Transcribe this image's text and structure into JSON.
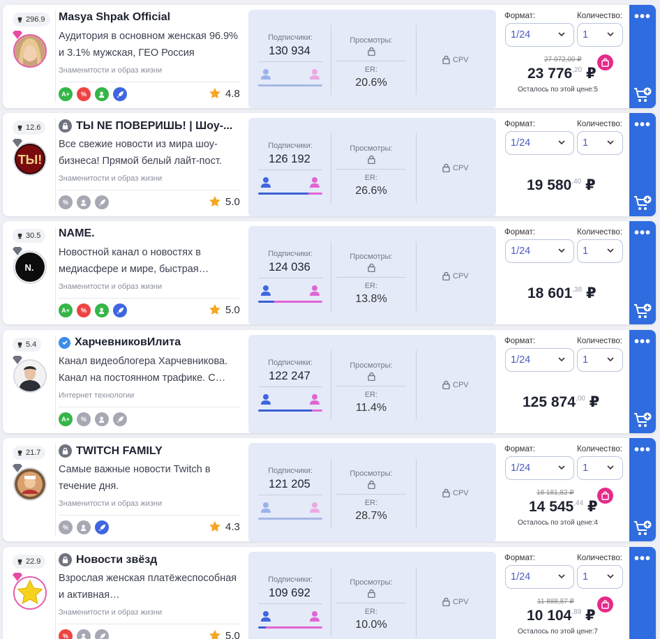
{
  "labels": {
    "subscribers": "Подписчики:",
    "views": "Просмотры:",
    "er": "ER:",
    "cpv": "CPV",
    "format": "Формат:",
    "quantity": "Количество:",
    "more": "•••"
  },
  "colors": {
    "accent": "#2f6ce0",
    "discount": "#e52a8a",
    "male": "#3f66e0",
    "female": "#e066d4"
  },
  "channels": [
    {
      "rank": "296.9",
      "name": "Masya Shpak Official",
      "desc": "Аудитория в основном женская 96.9% и 3.1% мужская, ГЕО Россия",
      "category": "Знаменитости и образ жизни",
      "subscribers": "130 934",
      "er": "20.6%",
      "male_share": 0.031,
      "format": "1/24",
      "qty": "1",
      "old_price": "27 972",
      "old_price_frac": ",00 ₽",
      "price": "23 776",
      "price_frac": ",20",
      "currency": "₽",
      "left_note": "Осталось по этой цене:5",
      "rating": "4.8",
      "tags": [
        "A+",
        "%",
        "pulse",
        "rocket"
      ]
    },
    {
      "rank": "12.6",
      "name": "ТЫ NE ПОВЕРИШЬ! | Шоу-...",
      "desc": "Все свежие новости из мира шоу-бизнеса! Прямой белый лайт-пост.",
      "category": "Знаменитости и образ жизни",
      "subscribers": "126 192",
      "er": "26.6%",
      "male_share": 0.78,
      "format": "1/24",
      "qty": "1",
      "price": "19 580",
      "price_frac": ",40",
      "currency": "₽",
      "rating": "5.0",
      "tags": [
        "%",
        "pulse",
        "rocket"
      ]
    },
    {
      "rank": "30.5",
      "name": "NAME.",
      "desc": "Новостной канал о новостях в медиасфере и мире, быстрая…",
      "category": "Знаменитости и образ жизни",
      "subscribers": "124 036",
      "er": "13.8%",
      "male_share": 0.25,
      "format": "1/24",
      "qty": "1",
      "price": "18 601",
      "price_frac": ",38",
      "currency": "₽",
      "rating": "5.0",
      "tags": [
        "A+",
        "%",
        "pulse",
        "rocket"
      ]
    },
    {
      "rank": "5.4",
      "name": "ХарчевниковИлита",
      "desc": "Канал видеоблогера Харчевникова. Канал на постоянном трафике. С…",
      "category": "Интернет технологии",
      "subscribers": "122 247",
      "er": "11.4%",
      "male_share": 0.84,
      "format": "1/24",
      "qty": "1",
      "price": "125 874",
      "price_frac": ",00",
      "currency": "₽",
      "tags": [
        "A+",
        "%",
        "pulse",
        "rocket"
      ]
    },
    {
      "rank": "21.7",
      "name": "TWITCH FAMILY",
      "desc": "Самые важные новости Twitch в течение дня.",
      "category": "Знаменитости и образ жизни",
      "subscribers": "121 205",
      "er": "28.7%",
      "male_share": 0.5,
      "format": "1/24",
      "qty": "1",
      "old_price": "18 181",
      "old_price_frac": ",82 ₽",
      "price": "14 545",
      "price_frac": ",44",
      "currency": "₽",
      "left_note": "Осталось по этой цене:4",
      "rating": "4.3",
      "tags": [
        "%",
        "pulse",
        "rocket"
      ]
    },
    {
      "rank": "22.9",
      "name": "Новости звёзд",
      "desc": "Взрослая женская платёжеспособная и активная…",
      "category": "Знаменитости и образ жизни",
      "subscribers": "109 692",
      "er": "10.0%",
      "male_share": 0.12,
      "format": "1/24",
      "qty": "1",
      "old_price": "11 888",
      "old_price_frac": ",87 ₽",
      "price": "10 104",
      "price_frac": ",89",
      "currency": "₽",
      "left_note": "Осталось по этой цене:7",
      "rating": "5.0",
      "tags": [
        "%",
        "pulse",
        "rocket"
      ]
    }
  ]
}
